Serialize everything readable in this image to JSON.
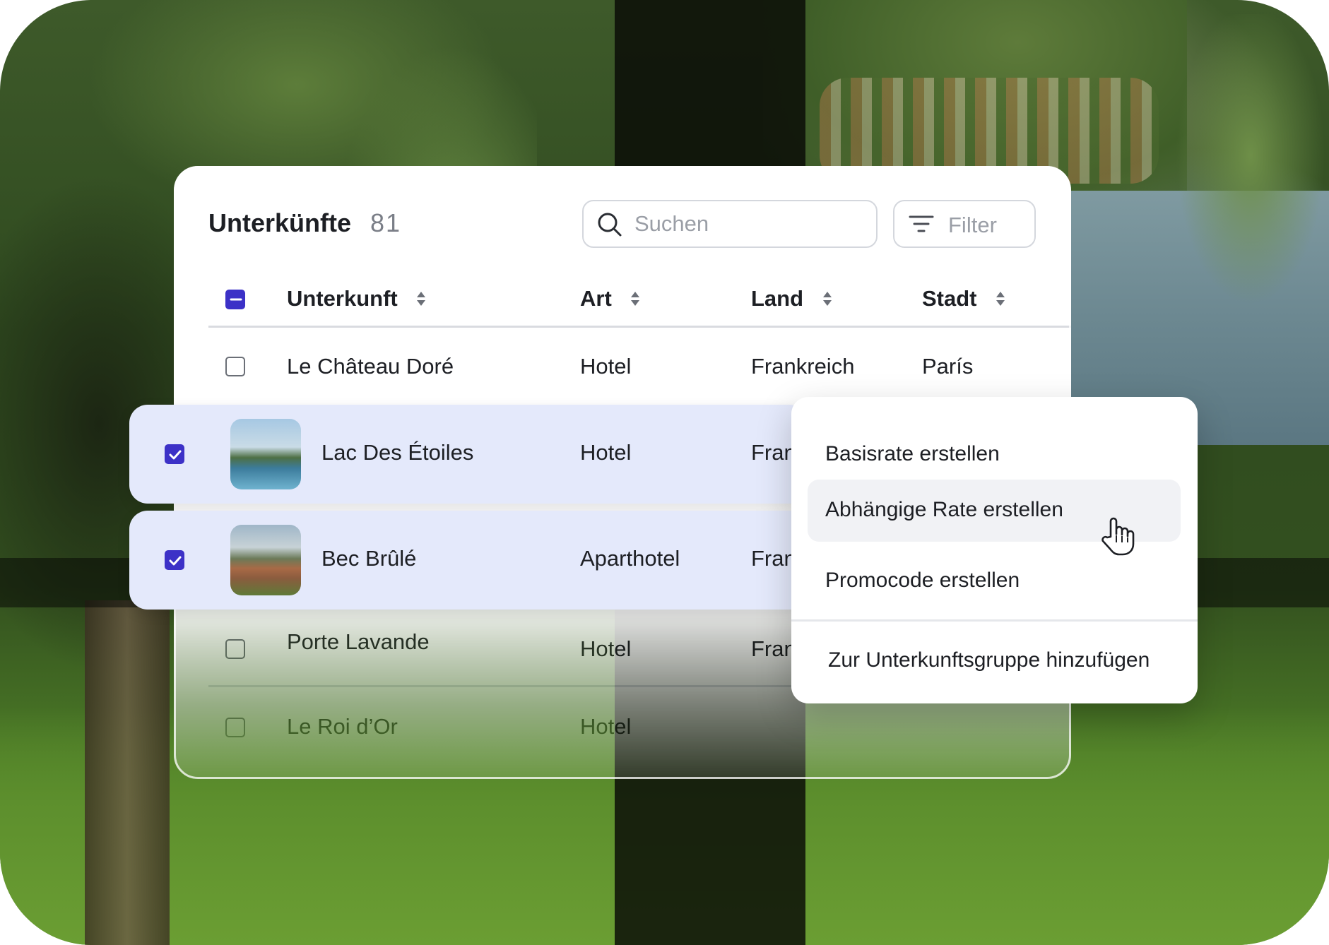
{
  "header": {
    "title": "Unterkünfte",
    "count": "81"
  },
  "search": {
    "placeholder": "Suchen",
    "value": ""
  },
  "filter": {
    "label": "Filter"
  },
  "table": {
    "columns": [
      "Unterkunft",
      "Art",
      "Land",
      "Stadt"
    ],
    "rows": [
      {
        "name": "Le Château Doré",
        "type": "Hotel",
        "country": "Frankreich",
        "city": "París",
        "selected": false
      },
      {
        "name": "Lac Des Étoiles",
        "type": "Hotel",
        "country": "Fran",
        "city": "",
        "selected": true
      },
      {
        "name": "Bec Brûlé",
        "type": "Aparthotel",
        "country": "Fran",
        "city": "",
        "selected": true
      },
      {
        "name": "Porte Lavande",
        "type": "Hotel",
        "country": "Fran",
        "city": "",
        "selected": false
      },
      {
        "name": "Le Roi d’Or",
        "type": "Hotel",
        "country": "",
        "city": "",
        "selected": false
      }
    ]
  },
  "context_menu": {
    "items": [
      "Basisrate erstellen",
      "Abhängige Rate erstellen",
      "Promocode erstellen",
      "Zur Unterkunftsgruppe hinzufügen"
    ],
    "hovered_index": 1
  },
  "colors": {
    "accent": "#3c31c7",
    "selected_row": "#e4e9fb",
    "text": "#1d1f24",
    "muted": "#9a9ea6"
  },
  "icons": {
    "search": "search-icon",
    "filter": "filter-lines-icon",
    "sort": "sort-arrows-icon",
    "cursor": "hand-pointer-icon"
  }
}
